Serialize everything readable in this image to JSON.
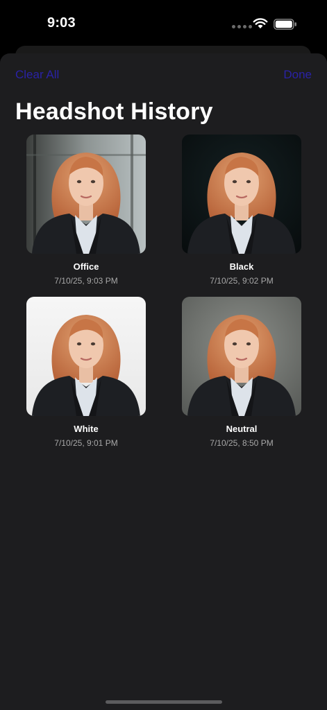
{
  "status_bar": {
    "time": "9:03"
  },
  "nav": {
    "clear_all_label": "Clear All",
    "done_label": "Done"
  },
  "page_title": "Headshot History",
  "headshots": [
    {
      "title": "Office",
      "date": "7/10/25, 9:03 PM",
      "background": "office"
    },
    {
      "title": "Black",
      "date": "7/10/25, 9:02 PM",
      "background": "black"
    },
    {
      "title": "White",
      "date": "7/10/25, 9:01 PM",
      "background": "white"
    },
    {
      "title": "Neutral",
      "date": "7/10/25, 8:50 PM",
      "background": "neutral"
    }
  ],
  "colors": {
    "accent": "#2a22a6",
    "sheet": "#1d1d1f",
    "subtext": "#a8a8a8"
  }
}
